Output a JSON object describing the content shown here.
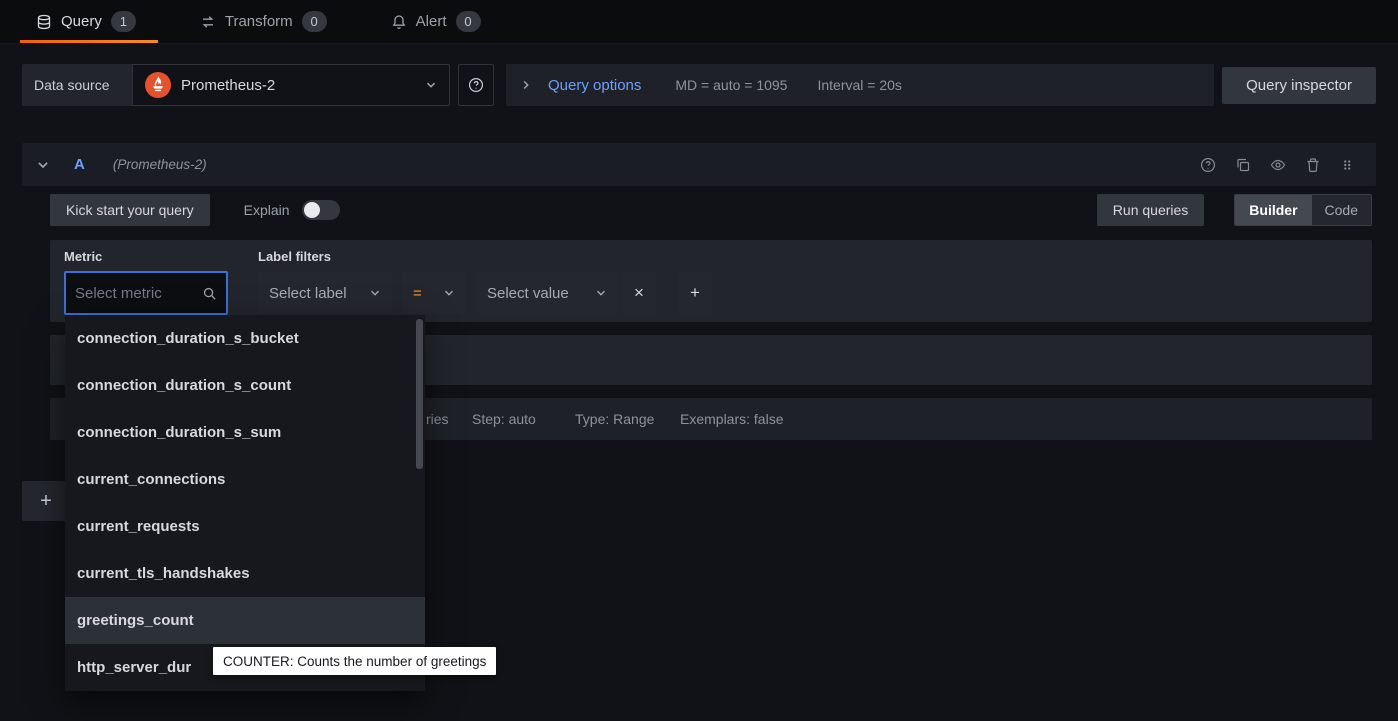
{
  "tabs": [
    {
      "label": "Query",
      "badge": "1"
    },
    {
      "label": "Transform",
      "badge": "0"
    },
    {
      "label": "Alert",
      "badge": "0"
    }
  ],
  "datasource_row": {
    "label": "Data source",
    "selected": "Prometheus-2",
    "query_options_link": "Query options",
    "max_data_points": "MD = auto = 1095",
    "interval": "Interval = 20s",
    "inspector_button": "Query inspector"
  },
  "query_row": {
    "ref_id": "A",
    "datasource_hint": "(Prometheus-2)",
    "kick_start_button": "Kick start your query",
    "explain_label": "Explain",
    "run_queries_button": "Run queries",
    "builder_toggle": "Builder",
    "code_toggle": "Code"
  },
  "builder": {
    "metric_label": "Metric",
    "metric_placeholder": "Select metric",
    "label_filters_label": "Label filters",
    "select_label_placeholder": "Select label",
    "operator": "=",
    "select_value_placeholder": "Select value",
    "remove_filter_glyph": "×",
    "add_filter_glyph": "+"
  },
  "options_row": {
    "fragment": "ries",
    "step": "Step: auto",
    "type": "Type: Range",
    "exemplars": "Exemplars: false"
  },
  "add_query_glyph": "+",
  "metric_dropdown": {
    "items": [
      "connection_duration_s_bucket",
      "connection_duration_s_count",
      "connection_duration_s_sum",
      "current_connections",
      "current_requests",
      "current_tls_handshakes",
      "greetings_count",
      "http_server_dur"
    ],
    "highlighted_item": "greetings_count"
  },
  "tooltip": "COUNTER: Counts the number of greetings",
  "icons": {
    "tab_query": "database-icon",
    "tab_transform": "transform-arrows-icon",
    "tab_alert": "bell-icon",
    "datasource": "prometheus-flame-icon",
    "help": "help-circle-icon",
    "query_options_expand": "chevron-right-icon",
    "dropdowns": "chevron-down-icon",
    "metric_search": "search-icon",
    "row_help": "help-circle-icon",
    "row_duplicate": "copy-icon",
    "row_hide": "eye-icon",
    "row_remove": "trash-icon",
    "row_drag": "drag-handle-icon"
  },
  "colors": {
    "accent_orange": "#ff780a",
    "link_blue": "#6e9fff",
    "prometheus_orange": "#e6522c",
    "focus_blue": "#3871dc",
    "operator_orange": "#ff9830",
    "tooltip_bg": "#ffffff"
  }
}
